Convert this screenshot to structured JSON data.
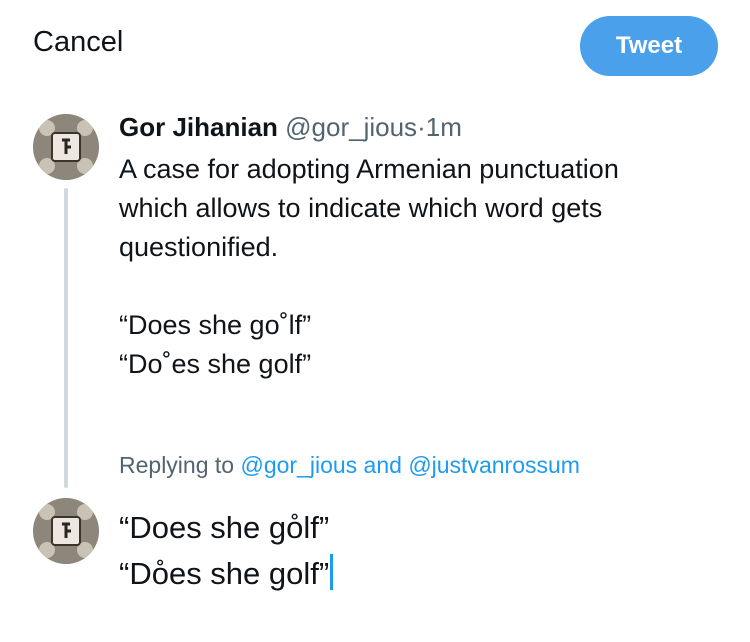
{
  "toolbar": {
    "cancel_label": "Cancel",
    "tweet_label": "Tweet"
  },
  "original_tweet": {
    "author_name": "Gor Jihanian",
    "handle": "@gor_jious",
    "separator": "·",
    "time": "1m",
    "text_lines": [
      "A case for adopting Armenian punctuation",
      "which allows to indicate which word gets",
      "questionified.",
      "“Does she go˚lf”",
      "“Do˚es she golf”"
    ]
  },
  "reply": {
    "replying_prefix": "Replying to",
    "mention_1": "@gor_jious",
    "conjunction": "and",
    "mention_2": "@justvanrossum",
    "draft_lines": [
      "“Does she go̊lf”",
      "“Do̊es she golf”"
    ]
  },
  "colors": {
    "accent": "#1d9bf0",
    "tweet_button": "#4aa0ea",
    "secondary_text": "#536471",
    "thread_line": "#cfd9de"
  },
  "icons": {
    "avatar": "armenian-letter-seal-avatar"
  }
}
